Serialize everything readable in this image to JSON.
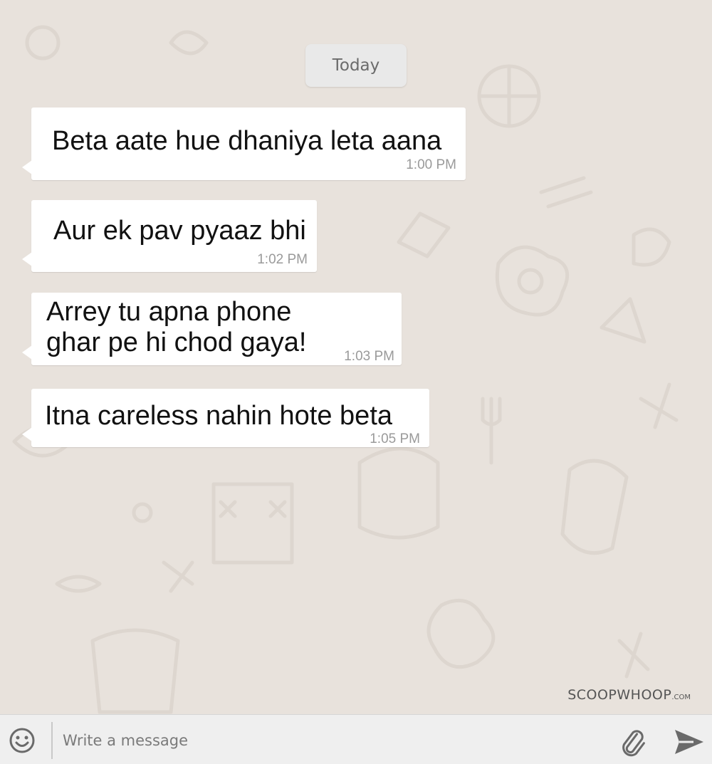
{
  "chat": {
    "date_label": "Today",
    "messages": [
      {
        "lines": [
          "Beta aate hue dhaniya leta aana"
        ],
        "time": "1:00 PM"
      },
      {
        "lines": [
          "Aur ek pav pyaaz bhi"
        ],
        "time": "1:02 PM"
      },
      {
        "lines": [
          "Arrey tu apna phone",
          "ghar pe hi chod gaya!"
        ],
        "time": "1:03 PM"
      },
      {
        "lines": [
          "Itna careless nahin hote beta"
        ],
        "time": "1:05 PM"
      }
    ]
  },
  "watermark": {
    "brand": "SCOOPWHOOP",
    "suffix": ".COM"
  },
  "composer": {
    "placeholder": "Write a message",
    "emoji_icon": "smiley-icon",
    "attach_icon": "paperclip-icon",
    "send_icon": "send-arrow-icon"
  },
  "colors": {
    "background": "#e8e2dc",
    "bubble": "#ffffff",
    "timestamp": "#9a9a9a",
    "input_bar": "#efefef"
  }
}
